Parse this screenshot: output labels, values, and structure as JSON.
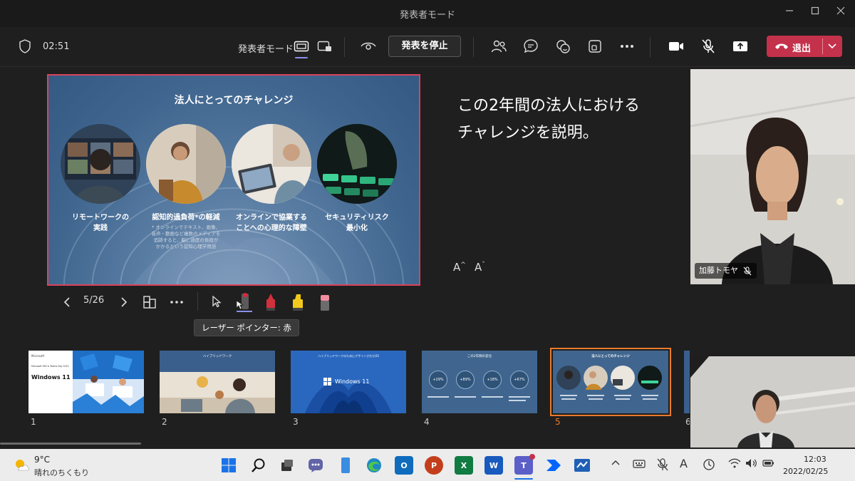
{
  "window": {
    "title": "発表者モード"
  },
  "toolbar": {
    "timer": "02:51",
    "presenter_mode_label": "発表者モード",
    "stop_label": "発表を停止",
    "leave_label": "退出",
    "accent": "#8a8fea",
    "leave_color": "#c4314b"
  },
  "slide": {
    "title": "法人にとってのチャレンジ",
    "items": [
      {
        "caption": "リモートワークの\n実践",
        "note": ""
      },
      {
        "caption": "認知的過負荷*の軽減",
        "note": "* オンラインでテキスト、画像、\n音声・動画など複数のメディアを\n追跡すると、脳に過度の負担が\nかかるという認知心理学用語"
      },
      {
        "caption": "オンラインで協業する\nことへの心理的な障壁",
        "note": ""
      },
      {
        "caption": "セキュリティリスク\n最小化",
        "note": ""
      }
    ]
  },
  "notes": {
    "text": "この2年間の法人における\nチャレンジを説明。"
  },
  "font_controls": {
    "increase": "A",
    "decrease": "A"
  },
  "slide_controls": {
    "counter": "5/26",
    "current": 5,
    "total": 26,
    "tooltip": "レーザー ポインター: 赤"
  },
  "participants": [
    {
      "name": "加藤トモヤ",
      "muted": true
    }
  ],
  "thumbnails": [
    {
      "num": "1",
      "windows_title": "Windows 11",
      "ms_label": "Microsoft",
      "event": "Microsoft 365 & Teams Day 2022",
      "selected": false
    },
    {
      "num": "2",
      "heading": "ハイブリッドワーク",
      "selected": false
    },
    {
      "num": "3",
      "heading": "ハイブリッドワークのためにデザインされたOS",
      "windows_title": "Windows 11",
      "selected": false
    },
    {
      "num": "4",
      "heading": "この2年間の変化",
      "stats": [
        "+29%",
        "+89%",
        "+18%",
        "+67%"
      ],
      "selected": false
    },
    {
      "num": "5",
      "heading": "法人にとってのチャレンジ",
      "selected": true
    },
    {
      "num": "6",
      "selected": false
    }
  ],
  "taskbar": {
    "weather_temp": "9°C",
    "weather_desc": "晴れのちくもり",
    "time": "12:03",
    "date": "2022/02/25",
    "ime": "A",
    "app_labels": {
      "outlook": "O",
      "powerpoint": "P",
      "excel": "X",
      "word": "W",
      "teams": "T"
    }
  }
}
